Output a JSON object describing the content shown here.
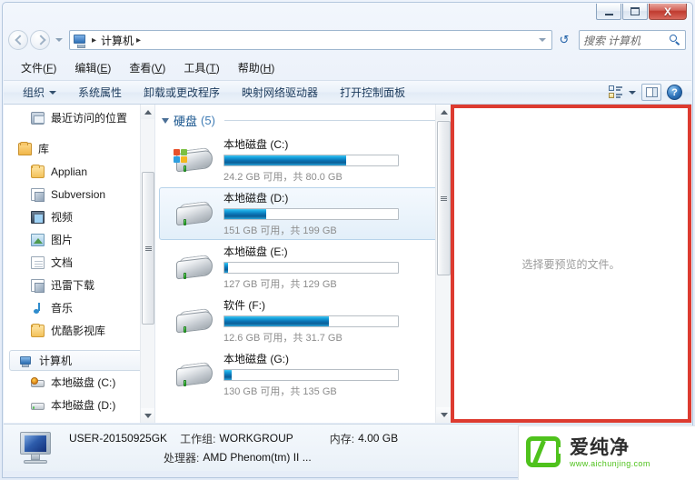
{
  "window": {
    "buttons": {
      "minimize": "–",
      "maximize": "□",
      "close": "X"
    }
  },
  "address_bar": {
    "back_tooltip": "后退",
    "forward_tooltip": "前进",
    "crumb_icon": "computer-icon",
    "crumb_label": "计算机",
    "sep1": "▸",
    "sep2": "▸",
    "refresh_glyph": "↺",
    "search_placeholder": "搜索 计算机"
  },
  "menu_bar": {
    "items": [
      {
        "text": "文件",
        "accel": "F"
      },
      {
        "text": "编辑",
        "accel": "E"
      },
      {
        "text": "查看",
        "accel": "V"
      },
      {
        "text": "工具",
        "accel": "T"
      },
      {
        "text": "帮助",
        "accel": "H"
      }
    ]
  },
  "command_bar": {
    "organize": "组织",
    "items": [
      "系统属性",
      "卸载或更改程序",
      "映射网络驱动器",
      "打开控制面板"
    ],
    "help_glyph": "?"
  },
  "sidebar": {
    "items": [
      {
        "label": "最近访问的位置",
        "icon": "recent-places-icon",
        "indent": 1,
        "selected": false
      },
      {
        "label": "库",
        "icon": "library-icon",
        "indent": 0,
        "selected": false,
        "gap_before": true
      },
      {
        "label": "Applian",
        "icon": "folder-icon",
        "indent": 1,
        "selected": false
      },
      {
        "label": "Subversion",
        "icon": "subversion-icon",
        "indent": 1,
        "selected": false
      },
      {
        "label": "视频",
        "icon": "video-icon",
        "indent": 1,
        "selected": false
      },
      {
        "label": "图片",
        "icon": "pictures-icon",
        "indent": 1,
        "selected": false
      },
      {
        "label": "文档",
        "icon": "documents-icon",
        "indent": 1,
        "selected": false
      },
      {
        "label": "迅雷下载",
        "icon": "thunder-download-icon",
        "indent": 1,
        "selected": false
      },
      {
        "label": "音乐",
        "icon": "music-icon",
        "indent": 1,
        "selected": false
      },
      {
        "label": "优酷影视库",
        "icon": "folder-icon",
        "indent": 1,
        "selected": false
      },
      {
        "label": "计算机",
        "icon": "computer-icon",
        "indent": 0,
        "selected": true,
        "gap_before": true
      },
      {
        "label": "本地磁盘 (C:)",
        "icon": "system-drive-icon",
        "indent": 1,
        "selected": false
      },
      {
        "label": "本地磁盘 (D:)",
        "icon": "hard-drive-icon",
        "indent": 1,
        "selected": false
      }
    ]
  },
  "content": {
    "group": {
      "title": "硬盘",
      "count": "(5)"
    },
    "drives": [
      {
        "name": "本地磁盘 (C:)",
        "capacity_text": "24.2 GB 可用，共 80.0 GB",
        "used_percent": 70,
        "bar_color": "#0a72b4",
        "system": true,
        "selected": false
      },
      {
        "name": "本地磁盘 (D:)",
        "capacity_text": "151 GB 可用，共 199 GB",
        "used_percent": 24,
        "bar_color": "#0a72b4",
        "system": false,
        "selected": true
      },
      {
        "name": "本地磁盘 (E:)",
        "capacity_text": "127 GB 可用，共 129 GB",
        "used_percent": 2,
        "bar_color": "#0a72b4",
        "system": false,
        "selected": false
      },
      {
        "name": "软件 (F:)",
        "capacity_text": "12.6 GB 可用，共 31.7 GB",
        "used_percent": 60,
        "bar_color": "#0a72b4",
        "system": false,
        "selected": false
      },
      {
        "name": "本地磁盘 (G:)",
        "capacity_text": "130 GB 可用，共 135 GB",
        "used_percent": 4,
        "bar_color": "#0a72b4",
        "system": false,
        "selected": false
      }
    ]
  },
  "preview_pane": {
    "message": "选择要预览的文件。",
    "highlight_color": "#dd3b30"
  },
  "details_pane": {
    "computer_name": "USER-20150925GK",
    "workgroup_key": "工作组:",
    "workgroup_value": "WORKGROUP",
    "memory_key": "内存:",
    "memory_value": "4.00 GB",
    "processor_key": "处理器:",
    "processor_value": "AMD Phenom(tm) II ..."
  },
  "watermark": {
    "brand_cn": "爱纯净",
    "url": "www.aichunjing.com",
    "color": "#4fc21c"
  }
}
